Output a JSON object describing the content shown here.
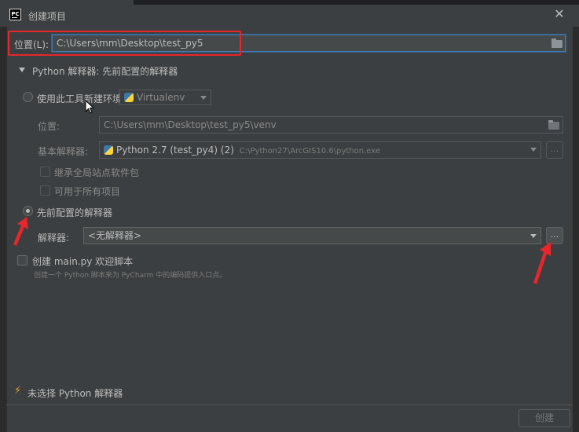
{
  "window": {
    "title": "创建项目",
    "app_icon_text": "PC"
  },
  "location": {
    "label": "位置(L):",
    "value": "C:\\Users\\mm\\Desktop\\test_py5"
  },
  "interpreter_section": {
    "header": "Python 解释器: 先前配置的解释器"
  },
  "new_env": {
    "radio_label": "使用此工具新建环境",
    "tool_select": "Virtualenv",
    "location_label": "位置:",
    "location_value": "C:\\Users\\mm\\Desktop\\test_py5\\venv",
    "base_label": "基本解释器:",
    "base_name": "Python 2.7 (test_py4) (2)",
    "base_path": "C:\\Python27\\ArcGIS10.6\\python.exe",
    "inherit_label": "继承全局站点软件包",
    "available_label": "可用于所有项目"
  },
  "existing": {
    "radio_label": "先前配置的解释器",
    "interpreter_label": "解释器:",
    "interpreter_value": "<无解释器>",
    "more_button": "..."
  },
  "main_script": {
    "checkbox_label": "创建 main.py 欢迎脚本",
    "description": "创建一个 Python 脚本来为 PyCharm 中的编码提供入口点。"
  },
  "footer": {
    "warning": "未选择 Python 解释器",
    "create_button": "创建"
  },
  "colors": {
    "annotation_red": "#e8262b",
    "focus_blue": "#3d7bb3",
    "warning_yellow": "#e0a328"
  },
  "icons": [
    "pycharm-icon",
    "close-icon",
    "folder-icon",
    "python-icon",
    "chevron-down-icon",
    "bolt-icon",
    "annotation-arrow-icon"
  ]
}
